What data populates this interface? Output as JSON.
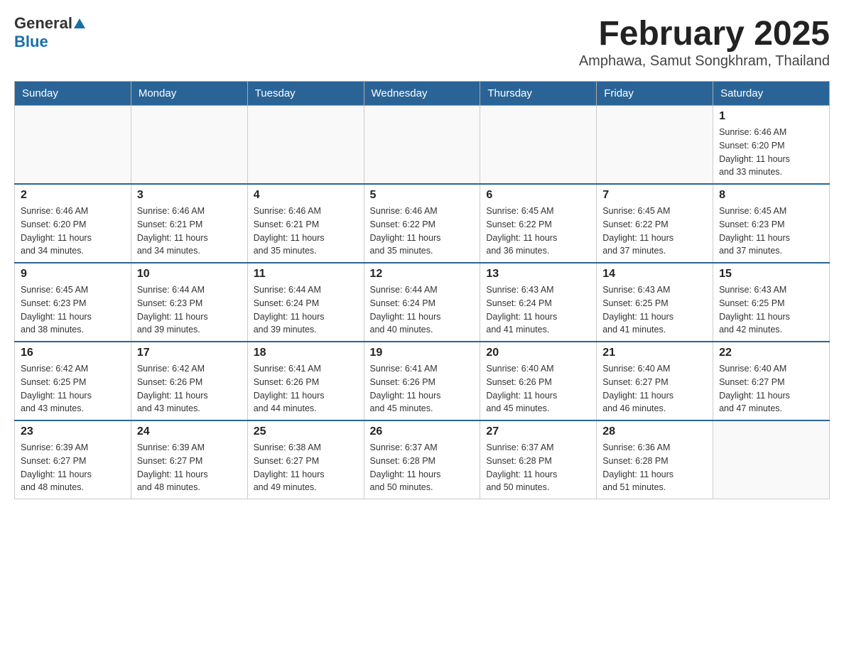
{
  "header": {
    "logo_general": "General",
    "logo_blue": "Blue",
    "month_title": "February 2025",
    "subtitle": "Amphawa, Samut Songkhram, Thailand"
  },
  "weekdays": [
    "Sunday",
    "Monday",
    "Tuesday",
    "Wednesday",
    "Thursday",
    "Friday",
    "Saturday"
  ],
  "weeks": [
    [
      {
        "day": "",
        "info": ""
      },
      {
        "day": "",
        "info": ""
      },
      {
        "day": "",
        "info": ""
      },
      {
        "day": "",
        "info": ""
      },
      {
        "day": "",
        "info": ""
      },
      {
        "day": "",
        "info": ""
      },
      {
        "day": "1",
        "info": "Sunrise: 6:46 AM\nSunset: 6:20 PM\nDaylight: 11 hours\nand 33 minutes."
      }
    ],
    [
      {
        "day": "2",
        "info": "Sunrise: 6:46 AM\nSunset: 6:20 PM\nDaylight: 11 hours\nand 34 minutes."
      },
      {
        "day": "3",
        "info": "Sunrise: 6:46 AM\nSunset: 6:21 PM\nDaylight: 11 hours\nand 34 minutes."
      },
      {
        "day": "4",
        "info": "Sunrise: 6:46 AM\nSunset: 6:21 PM\nDaylight: 11 hours\nand 35 minutes."
      },
      {
        "day": "5",
        "info": "Sunrise: 6:46 AM\nSunset: 6:22 PM\nDaylight: 11 hours\nand 35 minutes."
      },
      {
        "day": "6",
        "info": "Sunrise: 6:45 AM\nSunset: 6:22 PM\nDaylight: 11 hours\nand 36 minutes."
      },
      {
        "day": "7",
        "info": "Sunrise: 6:45 AM\nSunset: 6:22 PM\nDaylight: 11 hours\nand 37 minutes."
      },
      {
        "day": "8",
        "info": "Sunrise: 6:45 AM\nSunset: 6:23 PM\nDaylight: 11 hours\nand 37 minutes."
      }
    ],
    [
      {
        "day": "9",
        "info": "Sunrise: 6:45 AM\nSunset: 6:23 PM\nDaylight: 11 hours\nand 38 minutes."
      },
      {
        "day": "10",
        "info": "Sunrise: 6:44 AM\nSunset: 6:23 PM\nDaylight: 11 hours\nand 39 minutes."
      },
      {
        "day": "11",
        "info": "Sunrise: 6:44 AM\nSunset: 6:24 PM\nDaylight: 11 hours\nand 39 minutes."
      },
      {
        "day": "12",
        "info": "Sunrise: 6:44 AM\nSunset: 6:24 PM\nDaylight: 11 hours\nand 40 minutes."
      },
      {
        "day": "13",
        "info": "Sunrise: 6:43 AM\nSunset: 6:24 PM\nDaylight: 11 hours\nand 41 minutes."
      },
      {
        "day": "14",
        "info": "Sunrise: 6:43 AM\nSunset: 6:25 PM\nDaylight: 11 hours\nand 41 minutes."
      },
      {
        "day": "15",
        "info": "Sunrise: 6:43 AM\nSunset: 6:25 PM\nDaylight: 11 hours\nand 42 minutes."
      }
    ],
    [
      {
        "day": "16",
        "info": "Sunrise: 6:42 AM\nSunset: 6:25 PM\nDaylight: 11 hours\nand 43 minutes."
      },
      {
        "day": "17",
        "info": "Sunrise: 6:42 AM\nSunset: 6:26 PM\nDaylight: 11 hours\nand 43 minutes."
      },
      {
        "day": "18",
        "info": "Sunrise: 6:41 AM\nSunset: 6:26 PM\nDaylight: 11 hours\nand 44 minutes."
      },
      {
        "day": "19",
        "info": "Sunrise: 6:41 AM\nSunset: 6:26 PM\nDaylight: 11 hours\nand 45 minutes."
      },
      {
        "day": "20",
        "info": "Sunrise: 6:40 AM\nSunset: 6:26 PM\nDaylight: 11 hours\nand 45 minutes."
      },
      {
        "day": "21",
        "info": "Sunrise: 6:40 AM\nSunset: 6:27 PM\nDaylight: 11 hours\nand 46 minutes."
      },
      {
        "day": "22",
        "info": "Sunrise: 6:40 AM\nSunset: 6:27 PM\nDaylight: 11 hours\nand 47 minutes."
      }
    ],
    [
      {
        "day": "23",
        "info": "Sunrise: 6:39 AM\nSunset: 6:27 PM\nDaylight: 11 hours\nand 48 minutes."
      },
      {
        "day": "24",
        "info": "Sunrise: 6:39 AM\nSunset: 6:27 PM\nDaylight: 11 hours\nand 48 minutes."
      },
      {
        "day": "25",
        "info": "Sunrise: 6:38 AM\nSunset: 6:27 PM\nDaylight: 11 hours\nand 49 minutes."
      },
      {
        "day": "26",
        "info": "Sunrise: 6:37 AM\nSunset: 6:28 PM\nDaylight: 11 hours\nand 50 minutes."
      },
      {
        "day": "27",
        "info": "Sunrise: 6:37 AM\nSunset: 6:28 PM\nDaylight: 11 hours\nand 50 minutes."
      },
      {
        "day": "28",
        "info": "Sunrise: 6:36 AM\nSunset: 6:28 PM\nDaylight: 11 hours\nand 51 minutes."
      },
      {
        "day": "",
        "info": ""
      }
    ]
  ]
}
